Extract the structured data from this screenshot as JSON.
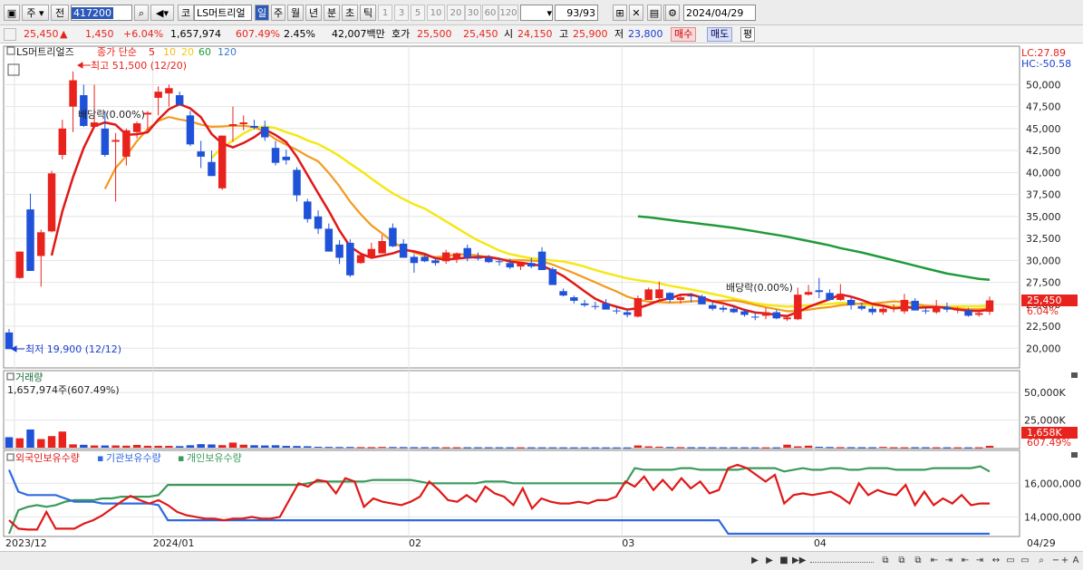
{
  "toolbar": {
    "mode_a": "주",
    "mode_b": "전",
    "code": "417200",
    "market": "코",
    "name": "LS머트리얼",
    "periods": [
      "일",
      "주",
      "월",
      "년",
      "분",
      "초",
      "틱"
    ],
    "active_period": "일",
    "intervals": [
      "1",
      "3",
      "5",
      "10",
      "20",
      "30",
      "60",
      "120"
    ],
    "count": "93",
    "count_total": "/93",
    "date": "2024/04/29"
  },
  "quote": {
    "price": "25,450",
    "change_arrow": "▲",
    "change": "1,450",
    "change_pct": "+6.04%",
    "volume": "1,657,974",
    "volume_ratio": "607.49%",
    "turnover": "2.45%",
    "amount": "42,007백만",
    "bid_label": "호가",
    "bid1": "25,500",
    "bid2": "25,450",
    "open_label": "시",
    "open": "24,150",
    "high_label": "고",
    "high": "25,900",
    "low_label": "저",
    "low": "23,800",
    "buy": "매수",
    "sell": "매도",
    "eval": "평"
  },
  "legend": {
    "name": "LS머트리얼즈",
    "ma_label": "종가 단순",
    "ma5": "5",
    "ma10": "10",
    "ma20": "20",
    "ma60": "60",
    "ma120": "120",
    "max_note": "최고 51,500 (12/20)",
    "min_note": "최저 19,900 (12/12)",
    "div1": "배당락(0.00%)",
    "div2": "배당락(0.00%)",
    "lc": "LC:27.89",
    "hc": "HC:-50.58"
  },
  "price_axis": {
    "ticks": [
      "50,000",
      "47,500",
      "45,000",
      "42,500",
      "40,000",
      "37,500",
      "35,000",
      "32,500",
      "30,000",
      "27,500",
      "25,000",
      "22,500",
      "20,000"
    ],
    "current_box": "25,450",
    "current_pct": "6.04%"
  },
  "volume_panel": {
    "title": "거래량",
    "info": "1,657,974주(607.49%)",
    "ticks": [
      "50,000K",
      "25,000K"
    ],
    "current_box": "1,658K",
    "current_pct": "607.49%"
  },
  "holding_panel": {
    "series": [
      "외국인보유수량",
      "기관보유수량",
      "개인보유수량"
    ],
    "ticks": [
      "16,000,000",
      "14,000,000"
    ]
  },
  "time_axis": [
    "2023/12",
    "2024/01",
    "02",
    "03",
    "04"
  ],
  "time_axis_right": "04/29",
  "colors": {
    "up": "#e8231d",
    "down": "#1f52d8",
    "ma5": "#e01818",
    "ma10": "#f39a1c",
    "ma20": "#f5e816",
    "ma60": "#1f9a3a",
    "foreign": "#e01818",
    "institution": "#2f6ae0",
    "individual": "#3a9a5a"
  },
  "chart_data": {
    "type": "candlestick",
    "candles": [
      {
        "o": 21800,
        "h": 22200,
        "l": 19900,
        "c": 19900
      },
      {
        "o": 28000,
        "h": 31000,
        "l": 27900,
        "c": 31000
      },
      {
        "o": 35800,
        "h": 37600,
        "l": 28800,
        "c": 28800
      },
      {
        "o": 30500,
        "h": 33500,
        "l": 27000,
        "c": 33200
      },
      {
        "o": 33300,
        "h": 40200,
        "l": 33200,
        "c": 39900
      },
      {
        "o": 42000,
        "h": 46000,
        "l": 41500,
        "c": 45000
      },
      {
        "o": 47500,
        "h": 51500,
        "l": 44600,
        "c": 50500
      },
      {
        "o": 48800,
        "h": 50000,
        "l": 45200,
        "c": 45300
      },
      {
        "o": 45200,
        "h": 50000,
        "l": 45200,
        "c": 45700
      },
      {
        "o": 45000,
        "h": 47000,
        "l": 41800,
        "c": 42000
      },
      {
        "o": 43500,
        "h": 44500,
        "l": 36700,
        "c": 43700
      },
      {
        "o": 41800,
        "h": 45000,
        "l": 40800,
        "c": 44800
      },
      {
        "o": 44600,
        "h": 45800,
        "l": 43900,
        "c": 45600
      },
      {
        "o": 46600,
        "h": 47000,
        "l": 44800,
        "c": 46800
      },
      {
        "o": 48500,
        "h": 49800,
        "l": 46500,
        "c": 49200
      },
      {
        "o": 49000,
        "h": 50000,
        "l": 47500,
        "c": 49600
      },
      {
        "o": 48800,
        "h": 49200,
        "l": 47600,
        "c": 47700
      },
      {
        "o": 46500,
        "h": 47000,
        "l": 43000,
        "c": 43200
      },
      {
        "o": 42400,
        "h": 43600,
        "l": 40500,
        "c": 41800
      },
      {
        "o": 41200,
        "h": 42500,
        "l": 39600,
        "c": 39600
      },
      {
        "o": 38200,
        "h": 44200,
        "l": 38000,
        "c": 44200
      },
      {
        "o": 45300,
        "h": 47500,
        "l": 43500,
        "c": 45500
      },
      {
        "o": 45500,
        "h": 46500,
        "l": 44800,
        "c": 45700
      },
      {
        "o": 45300,
        "h": 46000,
        "l": 44900,
        "c": 45100
      },
      {
        "o": 45200,
        "h": 45900,
        "l": 43600,
        "c": 44000
      },
      {
        "o": 42800,
        "h": 43600,
        "l": 40800,
        "c": 41100
      },
      {
        "o": 41800,
        "h": 42600,
        "l": 40900,
        "c": 41400
      },
      {
        "o": 40300,
        "h": 40600,
        "l": 36700,
        "c": 37400
      },
      {
        "o": 36700,
        "h": 37000,
        "l": 34300,
        "c": 34700
      },
      {
        "o": 35000,
        "h": 35700,
        "l": 33000,
        "c": 33600
      },
      {
        "o": 33600,
        "h": 34200,
        "l": 31100,
        "c": 31000
      },
      {
        "o": 31800,
        "h": 32300,
        "l": 29600,
        "c": 30300
      },
      {
        "o": 32000,
        "h": 32400,
        "l": 28100,
        "c": 28300
      },
      {
        "o": 29700,
        "h": 30900,
        "l": 29600,
        "c": 30600
      },
      {
        "o": 30300,
        "h": 32000,
        "l": 30300,
        "c": 31300
      },
      {
        "o": 30800,
        "h": 32900,
        "l": 30800,
        "c": 32200
      },
      {
        "o": 33700,
        "h": 34200,
        "l": 31500,
        "c": 31600
      },
      {
        "o": 31900,
        "h": 32400,
        "l": 30300,
        "c": 30300
      },
      {
        "o": 30400,
        "h": 30700,
        "l": 28600,
        "c": 29700
      },
      {
        "o": 30400,
        "h": 30800,
        "l": 29800,
        "c": 29900
      },
      {
        "o": 30000,
        "h": 30400,
        "l": 29400,
        "c": 29700
      },
      {
        "o": 29900,
        "h": 31200,
        "l": 29600,
        "c": 30900
      },
      {
        "o": 30200,
        "h": 30900,
        "l": 29700,
        "c": 30800
      },
      {
        "o": 31400,
        "h": 31800,
        "l": 29900,
        "c": 30300
      },
      {
        "o": 30300,
        "h": 30900,
        "l": 30000,
        "c": 30200
      },
      {
        "o": 30300,
        "h": 30600,
        "l": 29700,
        "c": 29800
      },
      {
        "o": 29900,
        "h": 30300,
        "l": 29400,
        "c": 29800
      },
      {
        "o": 29700,
        "h": 30200,
        "l": 29000,
        "c": 29200
      },
      {
        "o": 29300,
        "h": 29800,
        "l": 28900,
        "c": 29700
      },
      {
        "o": 29700,
        "h": 30300,
        "l": 29100,
        "c": 29300
      },
      {
        "o": 31000,
        "h": 31500,
        "l": 28900,
        "c": 28900
      },
      {
        "o": 29000,
        "h": 29200,
        "l": 27200,
        "c": 27200
      },
      {
        "o": 26500,
        "h": 26800,
        "l": 25900,
        "c": 26000
      },
      {
        "o": 25800,
        "h": 26000,
        "l": 25100,
        "c": 25400
      },
      {
        "o": 25100,
        "h": 25500,
        "l": 24700,
        "c": 24900
      },
      {
        "o": 24800,
        "h": 25300,
        "l": 24400,
        "c": 24700
      },
      {
        "o": 25100,
        "h": 25600,
        "l": 24500,
        "c": 24400
      },
      {
        "o": 24300,
        "h": 24700,
        "l": 23900,
        "c": 24200
      },
      {
        "o": 24100,
        "h": 24400,
        "l": 23500,
        "c": 23800
      },
      {
        "o": 23600,
        "h": 26000,
        "l": 23500,
        "c": 25700
      },
      {
        "o": 25500,
        "h": 26900,
        "l": 25500,
        "c": 26700
      },
      {
        "o": 25700,
        "h": 27600,
        "l": 25600,
        "c": 26700
      },
      {
        "o": 26300,
        "h": 26400,
        "l": 25200,
        "c": 25500
      },
      {
        "o": 25500,
        "h": 26000,
        "l": 25100,
        "c": 25800
      },
      {
        "o": 26000,
        "h": 26300,
        "l": 25200,
        "c": 25900
      },
      {
        "o": 25900,
        "h": 26100,
        "l": 25000,
        "c": 25000
      },
      {
        "o": 24900,
        "h": 25300,
        "l": 24300,
        "c": 24500
      },
      {
        "o": 24600,
        "h": 24900,
        "l": 24100,
        "c": 24400
      },
      {
        "o": 24500,
        "h": 24800,
        "l": 24000,
        "c": 24100
      },
      {
        "o": 24200,
        "h": 24500,
        "l": 23600,
        "c": 23800
      },
      {
        "o": 23600,
        "h": 24200,
        "l": 23200,
        "c": 23500
      },
      {
        "o": 23700,
        "h": 24600,
        "l": 23300,
        "c": 24100
      },
      {
        "o": 24100,
        "h": 24400,
        "l": 23300,
        "c": 23400
      },
      {
        "o": 23300,
        "h": 23600,
        "l": 23100,
        "c": 23500
      },
      {
        "o": 23300,
        "h": 26900,
        "l": 23200,
        "c": 26100
      },
      {
        "o": 26100,
        "h": 27200,
        "l": 26000,
        "c": 26400
      },
      {
        "o": 26600,
        "h": 28000,
        "l": 25700,
        "c": 26400
      },
      {
        "o": 26300,
        "h": 26700,
        "l": 25600,
        "c": 25500
      },
      {
        "o": 25500,
        "h": 27300,
        "l": 25400,
        "c": 26200
      },
      {
        "o": 25500,
        "h": 25800,
        "l": 24400,
        "c": 24900
      },
      {
        "o": 24800,
        "h": 25200,
        "l": 24300,
        "c": 24500
      },
      {
        "o": 24500,
        "h": 24800,
        "l": 23800,
        "c": 24100
      },
      {
        "o": 24100,
        "h": 24700,
        "l": 23800,
        "c": 24500
      },
      {
        "o": 24500,
        "h": 25000,
        "l": 24100,
        "c": 24700
      },
      {
        "o": 24200,
        "h": 26200,
        "l": 23900,
        "c": 25500
      },
      {
        "o": 25400,
        "h": 25700,
        "l": 24300,
        "c": 24300
      },
      {
        "o": 24300,
        "h": 24600,
        "l": 23900,
        "c": 24200
      },
      {
        "o": 24100,
        "h": 25500,
        "l": 23900,
        "c": 24700
      },
      {
        "o": 24700,
        "h": 25200,
        "l": 24100,
        "c": 24400
      },
      {
        "o": 24400,
        "h": 24700,
        "l": 24000,
        "c": 24400
      },
      {
        "o": 24300,
        "h": 24600,
        "l": 23600,
        "c": 23700
      },
      {
        "o": 23800,
        "h": 24200,
        "l": 23600,
        "c": 24000
      },
      {
        "o": 24150,
        "h": 25900,
        "l": 23800,
        "c": 25450
      }
    ],
    "ma60_start_index": 59,
    "ma60": [
      35000,
      34900,
      34750,
      34600,
      34450,
      34300,
      34150,
      34000,
      33850,
      33700,
      33500,
      33300,
      33100,
      32900,
      32700,
      32450,
      32200,
      31950,
      31700,
      31400,
      31150,
      30900,
      30600,
      30300,
      30000,
      29700,
      29400,
      29100,
      28800,
      28500,
      28300,
      28100,
      27900,
      27800
    ],
    "volume_k": [
      9500,
      8500,
      16500,
      7800,
      10500,
      14600,
      3000,
      2600,
      2000,
      2000,
      2000,
      1800,
      2500,
      1700,
      1700,
      1600,
      1400,
      2200,
      3200,
      2900,
      2300,
      4600,
      2700,
      2200,
      2000,
      2200,
      1600,
      1500,
      1300,
      800,
      700,
      600,
      650,
      550,
      500,
      700,
      600,
      550,
      480,
      450,
      420,
      400,
      390,
      380,
      370,
      360,
      350,
      340,
      330,
      320,
      310,
      300,
      290,
      280,
      270,
      260,
      250,
      240,
      230,
      2000,
      1200,
      900,
      600,
      500,
      400,
      380,
      360,
      350,
      340,
      330,
      320,
      310,
      300,
      2700,
      1200,
      1800,
      800,
      600,
      500,
      450,
      400,
      380,
      700,
      400,
      350,
      400,
      380,
      350,
      330,
      320,
      300,
      350,
      1658
    ],
    "volume_ylim": [
      0,
      60000
    ],
    "price_ylim": [
      19000,
      52000
    ],
    "holding_ylim": [
      13000000,
      17200000
    ],
    "foreign": [
      13800000,
      13300000,
      13250000,
      13250000,
      14300000,
      13300000,
      13300000,
      13300000,
      13600000,
      13800000,
      14100000,
      14500000,
      14900000,
      15250000,
      15000000,
      14800000,
      15000000,
      14700000,
      14300000,
      14100000,
      14000000,
      13900000,
      13900000,
      13800000,
      13900000,
      13900000,
      14000000,
      13900000,
      13900000,
      14000000,
      15000000,
      16000000,
      15800000,
      16200000,
      16100000,
      15400000,
      16300000,
      16100000,
      14600000,
      15100000,
      14900000,
      14800000,
      14700000,
      14900000,
      15200000,
      16100000,
      15600000,
      15000000,
      14900000,
      15300000,
      14900000,
      15800000,
      15400000,
      15200000,
      14700000,
      15700000,
      14500000,
      15100000,
      14900000,
      14800000,
      14800000,
      14900000,
      14800000,
      15000000,
      15000000,
      15200000,
      16100000,
      15800000,
      16400000,
      15600000,
      16200000,
      15600000,
      16300000,
      15700000,
      16100000,
      15400000,
      15600000,
      16900000,
      17100000,
      16900000,
      16500000,
      16100000,
      16500000,
      14800000,
      15300000,
      15400000,
      15300000,
      15400000,
      15500000,
      15200000,
      14800000,
      16000000,
      15300000,
      15600000,
      15400000,
      15300000,
      15900000,
      14700000,
      15500000,
      14700000,
      15100000,
      14800000,
      15300000,
      14700000,
      14800000,
      14800000
    ],
    "institution": [
      16800000,
      15500000,
      15300000,
      15300000,
      15300000,
      15300000,
      15100000,
      14900000,
      14900000,
      14900000,
      14800000,
      14800000,
      14800000,
      14800000,
      14800000,
      14800000,
      14700000,
      13800000,
      13800000,
      13800000,
      13800000,
      13800000,
      13800000,
      13800000,
      13800000,
      13800000,
      13800000,
      13800000,
      13800000,
      13800000,
      13800000,
      13800000,
      13800000,
      13800000,
      13800000,
      13800000,
      13800000,
      13800000,
      13800000,
      13800000,
      13800000,
      13800000,
      13800000,
      13800000,
      13800000,
      13800000,
      13800000,
      13800000,
      13800000,
      13800000,
      13800000,
      13800000,
      13800000,
      13800000,
      13800000,
      13800000,
      13800000,
      13800000,
      13800000,
      13800000,
      13800000,
      13800000,
      13800000,
      13800000,
      13800000,
      13800000,
      13800000,
      13800000,
      13800000,
      13800000,
      13800000,
      13800000,
      13800000,
      13800000,
      13800000,
      13800000,
      13800000,
      13000000,
      13000000,
      13000000,
      13000000,
      13000000,
      13000000,
      13000000,
      13000000,
      13000000,
      13000000,
      13000000,
      13000000,
      13000000,
      13000000,
      13000000,
      13000000,
      13000000,
      13000000,
      13000000,
      13000000,
      13000000,
      13000000,
      13000000,
      13000000,
      13000000,
      13000000,
      13000000,
      13000000,
      13000000
    ],
    "individual": [
      13000000,
      14400000,
      14600000,
      14700000,
      14600000,
      14700000,
      14900000,
      15000000,
      15000000,
      15000000,
      15100000,
      15100000,
      15200000,
      15200000,
      15200000,
      15200000,
      15300000,
      15900000,
      15900000,
      15900000,
      15900000,
      15900000,
      15900000,
      15900000,
      15900000,
      15900000,
      15900000,
      15900000,
      15900000,
      15900000,
      15900000,
      15900000,
      16000000,
      16100000,
      16100000,
      16100000,
      16100000,
      16100000,
      16100000,
      16200000,
      16200000,
      16200000,
      16200000,
      16200000,
      16100000,
      16000000,
      16000000,
      16000000,
      16000000,
      16000000,
      16000000,
      16100000,
      16100000,
      16100000,
      16000000,
      16000000,
      16000000,
      16000000,
      16000000,
      16000000,
      16000000,
      16000000,
      16000000,
      16000000,
      16000000,
      16000000,
      16000000,
      16900000,
      16800000,
      16800000,
      16800000,
      16800000,
      16900000,
      16900000,
      16800000,
      16800000,
      16800000,
      16800000,
      16800000,
      16900000,
      16900000,
      16900000,
      16900000,
      16700000,
      16800000,
      16900000,
      16800000,
      16800000,
      16900000,
      16900000,
      16800000,
      16800000,
      16900000,
      16900000,
      16900000,
      16800000,
      16800000,
      16800000,
      16800000,
      16900000,
      16900000,
      16900000,
      16900000,
      16900000,
      17000000,
      16700000
    ]
  }
}
